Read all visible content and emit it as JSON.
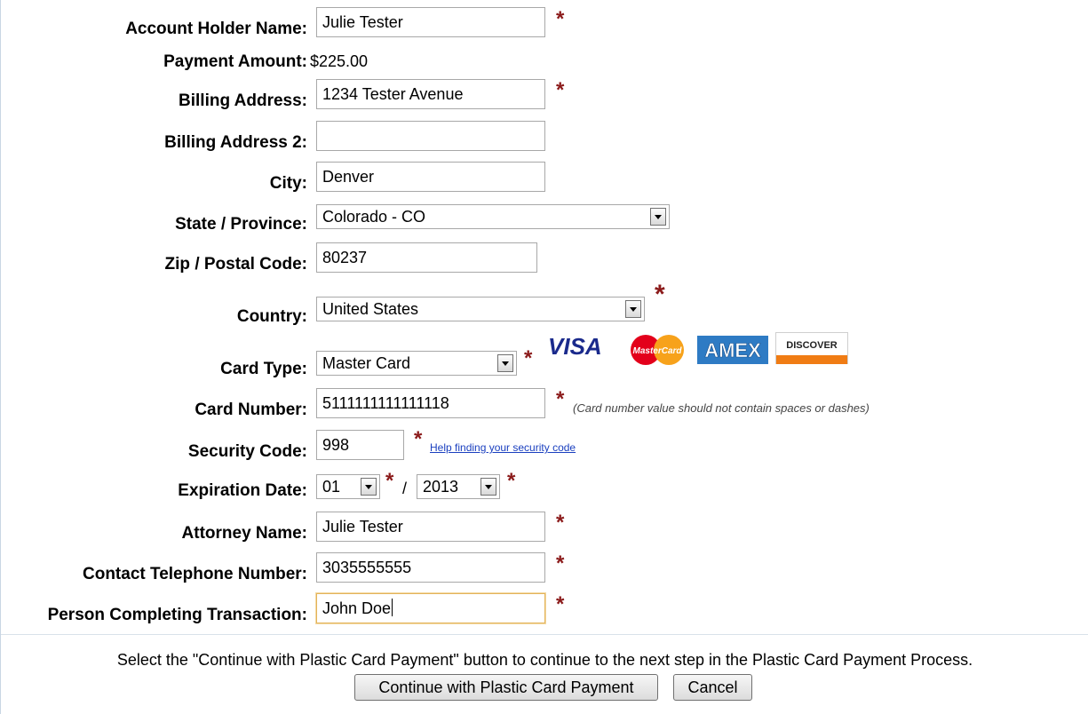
{
  "form": {
    "account_holder": {
      "label": "Account Holder Name:",
      "value": "Julie Tester"
    },
    "payment_amount": {
      "label": "Payment Amount:",
      "value": "$225.00"
    },
    "billing_address": {
      "label": "Billing Address:",
      "value": "1234 Tester Avenue"
    },
    "billing_address2": {
      "label": "Billing Address 2:",
      "value": ""
    },
    "city": {
      "label": "City:",
      "value": "Denver"
    },
    "state": {
      "label": "State / Province:",
      "value": "Colorado - CO"
    },
    "zip": {
      "label": "Zip / Postal Code:",
      "value": "80237"
    },
    "country": {
      "label": "Country:",
      "value": "United States"
    },
    "card_type": {
      "label": "Card Type:",
      "value": "Master Card"
    },
    "card_number": {
      "label": "Card Number:",
      "value": "5111111111111118",
      "note": "(Card number value should not contain spaces or dashes)"
    },
    "security_code": {
      "label": "Security Code:",
      "value": "998",
      "help_link": "Help finding your security code"
    },
    "expiration": {
      "label": "Expiration Date:",
      "month": "01",
      "year": "2013",
      "separator": "/"
    },
    "attorney": {
      "label": "Attorney Name:",
      "value": "Julie Tester"
    },
    "phone": {
      "label": "Contact Telephone Number:",
      "value": "3035555555"
    },
    "person": {
      "label": "Person Completing Transaction:",
      "value": "John Doe"
    },
    "required_mark": "*"
  },
  "cards": {
    "visa": "VISA",
    "mastercard": "MasterCard",
    "amex": "AMEX",
    "discover": "DISCOVER"
  },
  "footer": {
    "instructions": "Select the \"Continue with Plastic Card Payment\" button to continue to the next step in the Plastic Card Payment Process.",
    "continue_label": "Continue with Plastic Card Payment",
    "cancel_label": "Cancel"
  },
  "colors": {
    "required": "#8b1a1a",
    "link": "#1a3fbf",
    "focus_border": "#e3b35a"
  }
}
